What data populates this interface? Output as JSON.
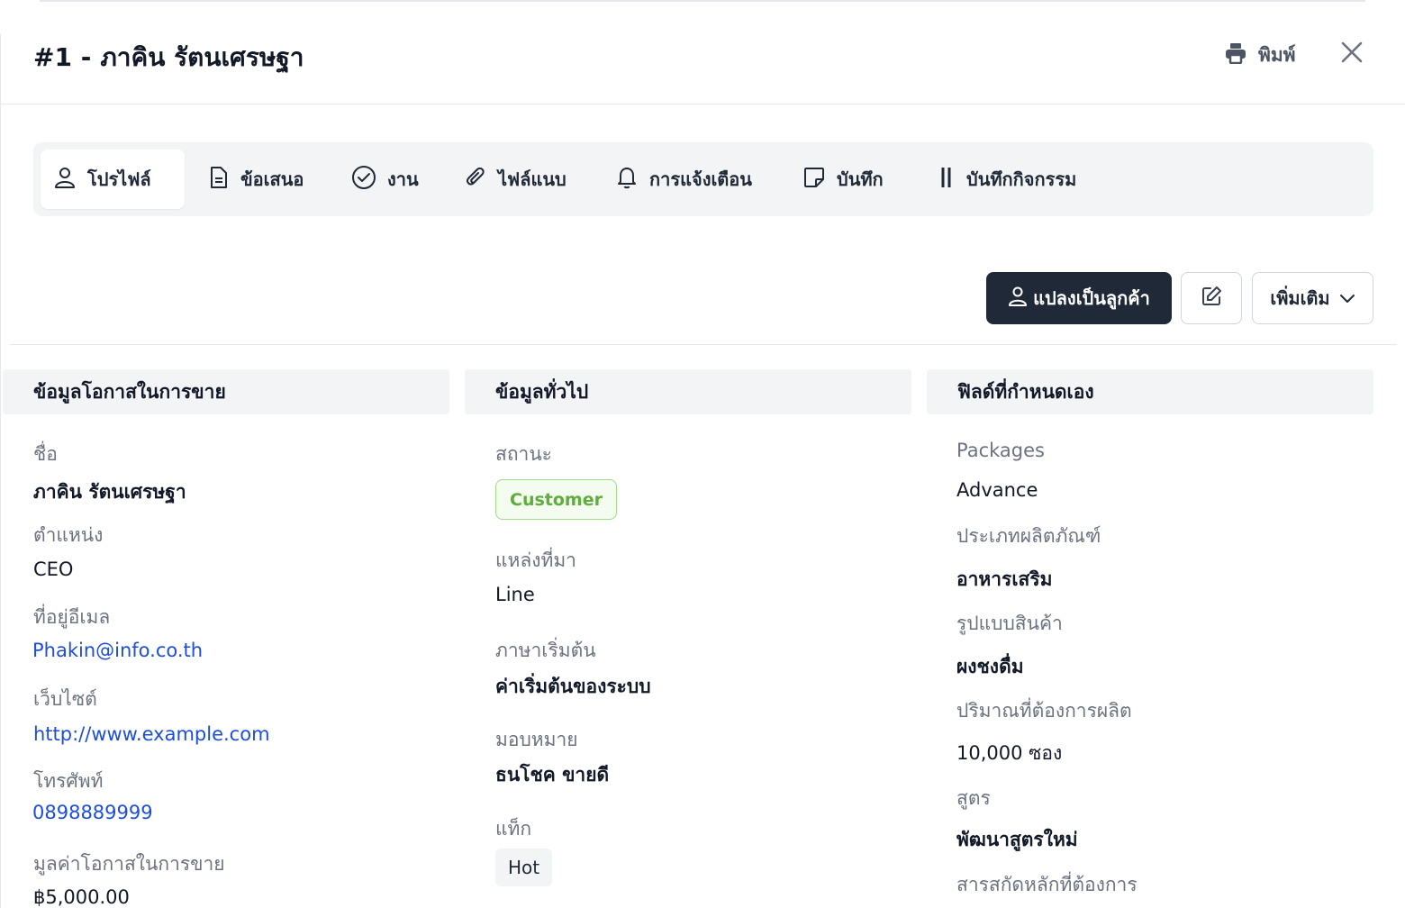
{
  "header": {
    "number": "#1 -",
    "name": "ภาคิน รัตนเศรษฐา",
    "print_label": "พิมพ์"
  },
  "tabs": [
    {
      "label": "โปรไฟล์",
      "icon": "user-icon",
      "active": true
    },
    {
      "label": "ข้อเสนอ",
      "icon": "document-icon",
      "active": false
    },
    {
      "label": "งาน",
      "icon": "check-circle-icon",
      "active": false
    },
    {
      "label": "ไฟล์แนบ",
      "icon": "paperclip-icon",
      "active": false
    },
    {
      "label": "การแจ้งเตือน",
      "icon": "bell-icon",
      "active": false
    },
    {
      "label": "บันทึก",
      "icon": "note-icon",
      "active": false
    },
    {
      "label": "บันทึกกิจกรรม",
      "icon": "activity-icon",
      "active": false
    }
  ],
  "actions": {
    "convert_label": "แปลงเป็นลูกค้า",
    "more_label": "เพิ่มเติม"
  },
  "columns": {
    "opportunity": {
      "heading": "ข้อมูลโอกาสในการขาย",
      "fields": [
        {
          "label": "ชื่อ",
          "value": "ภาคิน รัตนเศรษฐา"
        },
        {
          "label": "ตำแหน่ง",
          "value": "CEO"
        },
        {
          "label": "ที่อยู่อีเมล",
          "value": "Phakin@info.co.th"
        },
        {
          "label": "เว็บไซต์",
          "value": "http://www.example.com"
        },
        {
          "label": "โทรศัพท์",
          "value": "0898889999"
        },
        {
          "label": "มูลค่าโอกาสในการขาย",
          "value": "฿5,000.00"
        }
      ]
    },
    "general": {
      "heading": "ข้อมูลทั่วไป",
      "status_label": "สถานะ",
      "status_value": "Customer",
      "source_label": "แหล่งที่มา",
      "source_value": "Line",
      "language_label": "ภาษาเริ่มต้น",
      "language_value": "ค่าเริ่มต้นของระบบ",
      "assigned_label": "มอบหมาย",
      "assigned_value": "ธนโชค ขายดี",
      "tags_label": "แท็ก",
      "tag_value": "Hot"
    },
    "custom": {
      "heading": "ฟิลด์ที่กำหนดเอง",
      "fields": [
        {
          "label": "Packages",
          "value": "Advance"
        },
        {
          "label": "ประเภทผลิตภัณฑ์",
          "value": "อาหารเสริม"
        },
        {
          "label": "รูปแบบสินค้า",
          "value": "ผงชงดื่ม"
        },
        {
          "label": "ปริมาณที่ต้องการผลิต",
          "value": "10,000 ซอง"
        },
        {
          "label": "สูตร",
          "value": "พัฒนาสูตรใหม่"
        },
        {
          "label": "สารสกัดหลักที่ต้องการ",
          "value": ""
        }
      ]
    }
  },
  "colors": {
    "primary_button": "#1f2937",
    "link": "#1d4ed8",
    "badge_green": "#5fae3d"
  }
}
